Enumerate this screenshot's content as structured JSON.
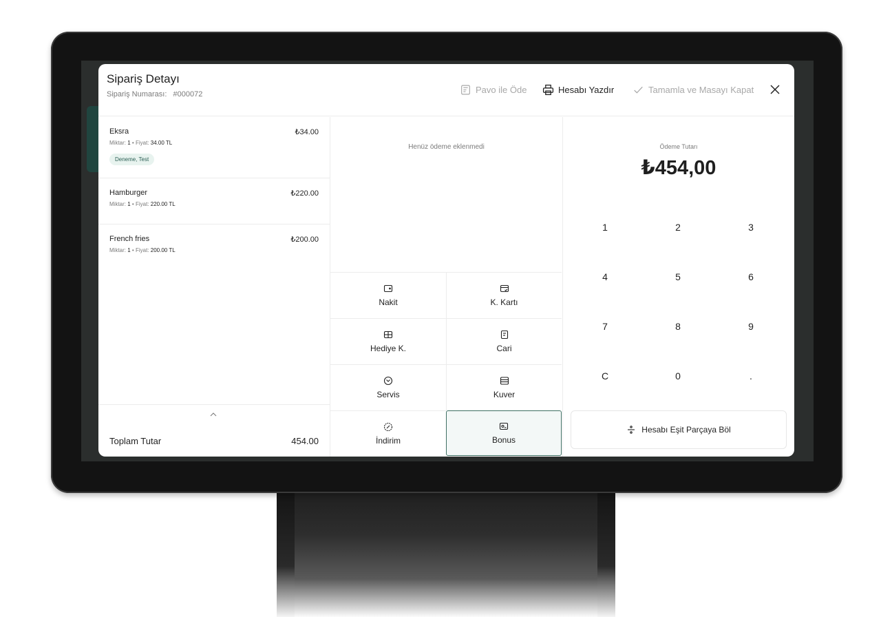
{
  "header": {
    "title": "Sipariş Detayı",
    "order_label": "Sipariş Numarası:",
    "order_number": "#000072",
    "pavo_label": "Pavo ile Öde",
    "print_label": "Hesabı Yazdır",
    "complete_label": "Tamamla ve Masayı Kapat"
  },
  "items": [
    {
      "name": "Eksra",
      "price": "₺34.00",
      "qty_label": "Miktar:",
      "qty": "1",
      "sep": "•",
      "price_label": "Fiyat:",
      "unit_price": "34.00 TL",
      "tag": "Deneme, Test"
    },
    {
      "name": "Hamburger",
      "price": "₺220.00",
      "qty_label": "Miktar:",
      "qty": "1",
      "sep": "•",
      "price_label": "Fiyat:",
      "unit_price": "220.00 TL"
    },
    {
      "name": "French fries",
      "price": "₺200.00",
      "qty_label": "Miktar:",
      "qty": "1",
      "sep": "•",
      "price_label": "Fiyat:",
      "unit_price": "200.00 TL"
    }
  ],
  "total": {
    "label": "Toplam Tutar",
    "value": "454.00"
  },
  "payments": {
    "empty_message": "Henüz ödeme eklenmedi",
    "methods": [
      "Nakit",
      "K. Kartı",
      "Hediye K.",
      "Cari",
      "Servis",
      "Kuver",
      "İndirim",
      "Bonus"
    ]
  },
  "amount": {
    "label": "Ödeme Tutarı",
    "value": "₺454,00"
  },
  "keypad": [
    "1",
    "2",
    "3",
    "4",
    "5",
    "6",
    "7",
    "8",
    "9",
    "C",
    "0",
    "."
  ],
  "split_label": "Hesabı Eşit Parçaya Böl",
  "colors": {
    "accent": "#3e6f63",
    "tag_bg": "#e8f3ef",
    "muted": "#a8a8a8"
  }
}
